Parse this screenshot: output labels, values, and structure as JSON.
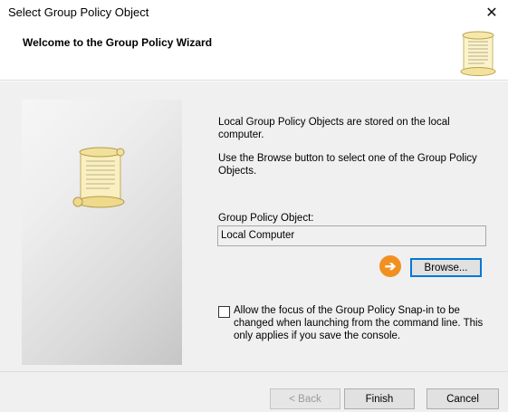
{
  "window": {
    "title": "Select Group Policy Object",
    "close_glyph": "✕"
  },
  "header": {
    "title": "Welcome to the Group Policy Wizard",
    "icon": "scroll-icon"
  },
  "side_panel": {
    "icon": "scroll-icon"
  },
  "content": {
    "description_1": "Local Group Policy Objects are stored on the local computer.",
    "description_2": "Use the Browse button to select one of the Group Policy Objects.",
    "gpo_label": "Group Policy Object:",
    "gpo_value": "Local Computer",
    "browse_label": "Browse...",
    "highlight_glyph": "➔",
    "highlight_color": "#f19021",
    "checkbox_label": "Allow the focus of the Group Policy Snap-in to be changed when launching from the command line.  This only applies if you save the console.",
    "checkbox_checked": false
  },
  "footer": {
    "back_label": "< Back",
    "finish_label": "Finish",
    "cancel_label": "Cancel"
  }
}
